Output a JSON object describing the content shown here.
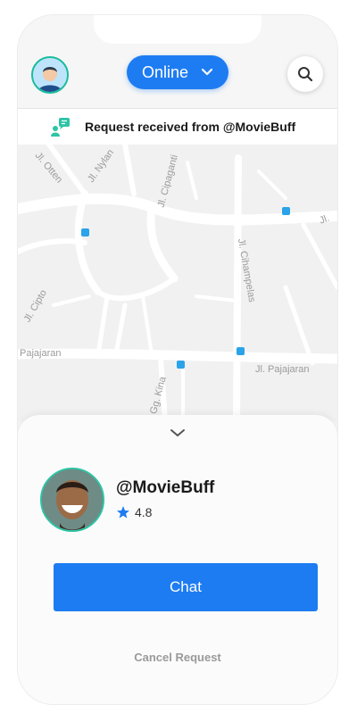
{
  "header": {
    "status": "Online",
    "status_color": "#1e7cf2"
  },
  "notification": {
    "text": "Request received from @MovieBuff",
    "icon": "chat-request-icon",
    "icon_color": "#2ec4a6"
  },
  "map": {
    "streets": [
      "Jl. Otten",
      "Jl. Nylan",
      "Jl. Cipaganti",
      "Jl. Cihampelas",
      "Jl. Cipto",
      "Pajajaran",
      "Jl. Pajajaran",
      "Gg. Kina",
      "Jl."
    ]
  },
  "request": {
    "username": "@MovieBuff",
    "rating": "4.8",
    "chat_label": "Chat",
    "cancel_label": "Cancel Request"
  }
}
